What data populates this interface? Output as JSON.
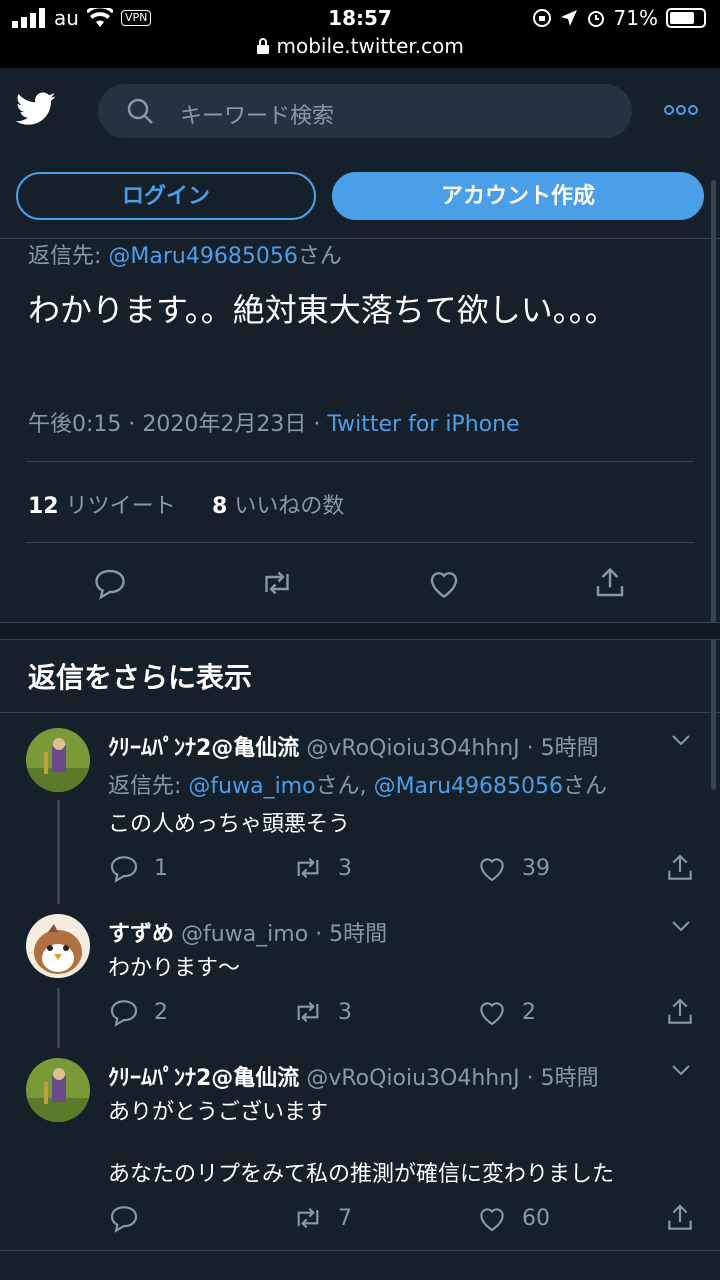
{
  "status_bar": {
    "carrier": "au",
    "vpn": "VPN",
    "time": "18:57",
    "battery": "71%",
    "url": "mobile.twitter.com"
  },
  "search": {
    "placeholder": "キーワード検索"
  },
  "buttons": {
    "login": "ログイン",
    "signup": "アカウント作成"
  },
  "tweet": {
    "reply_prefix": "返信先: ",
    "reply_handle": "@Maru49685056",
    "reply_suffix": "さん",
    "text": "わかります。。絶対東大落ちて欲しい。。。",
    "time": "午後0:15 · 2020年2月23日 · ",
    "source": "Twitter for iPhone",
    "retweet_count": "12",
    "retweet_label": "リツイート",
    "like_count": "8",
    "like_label": "いいねの数"
  },
  "more_replies_title": "返信をさらに表示",
  "replies": [
    {
      "name": "ｸﾘｰﾑﾊﾟﾝﾅ2@亀仙流",
      "handle": "@vRoQioiu3O4hhnJ",
      "time": "· 5時間",
      "reply_prefix": "返信先: ",
      "reply_handle_1": "@fuwa_imo",
      "reply_mid": "さん, ",
      "reply_handle_2": "@Maru49685056",
      "reply_suffix": "さん",
      "text": "この人めっちゃ頭悪そう",
      "replies": "1",
      "retweets": "3",
      "likes": "39"
    },
    {
      "name": "すずめ",
      "handle": "@fuwa_imo",
      "time": "· 5時間",
      "text": "わかります〜",
      "replies": "2",
      "retweets": "3",
      "likes": "2"
    },
    {
      "name": "ｸﾘｰﾑﾊﾟﾝﾅ2@亀仙流",
      "handle": "@vRoQioiu3O4hhnJ",
      "time": "· 5時間",
      "text_line1": "ありがとうございます",
      "text_line2": "あなたのリプをみて私の推測が確信に変わりました",
      "replies": "",
      "retweets": "7",
      "likes": "60"
    }
  ],
  "colors": {
    "background": "#15202b",
    "accent": "#4a9fe8",
    "secondary_text": "#8899a6",
    "border": "#38444d"
  }
}
